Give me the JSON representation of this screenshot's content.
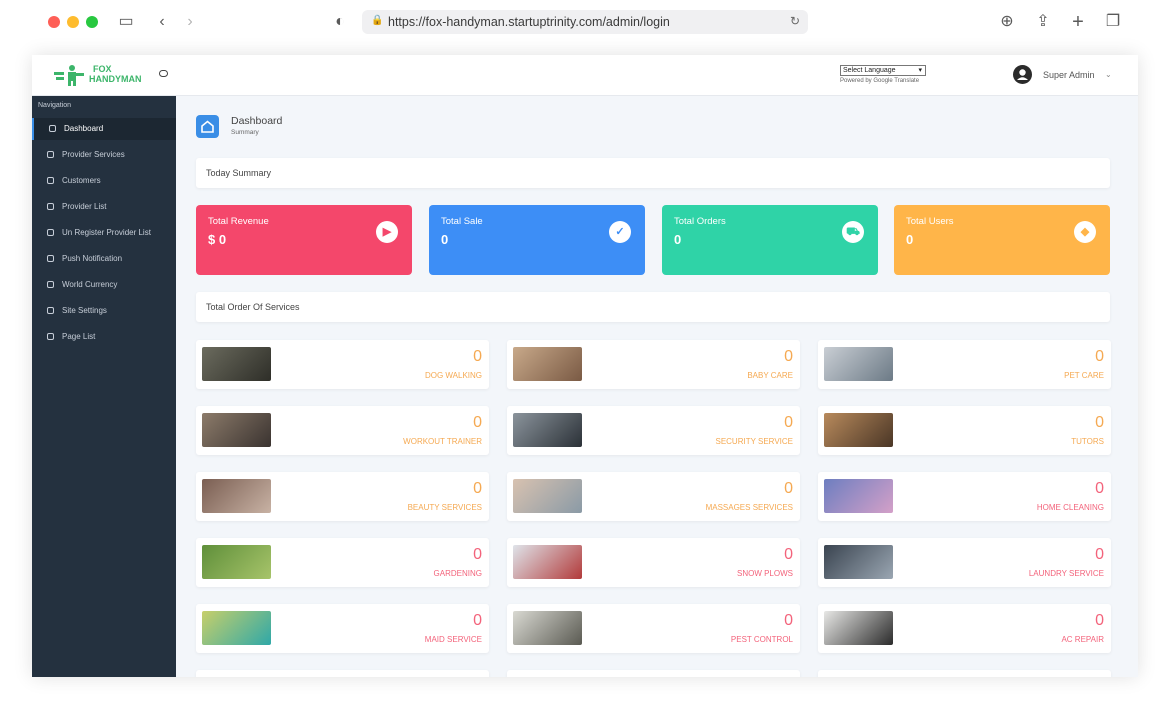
{
  "browser": {
    "url": "https://fox-handyman.startuptrinity.com/admin/login"
  },
  "header": {
    "logo_line1": "FOX",
    "logo_line2": "HANDYMAN",
    "language_select": "Select Language",
    "powered_by": "Powered by Google Translate",
    "user_name": "Super Admin"
  },
  "sidebar": {
    "heading": "Navigation",
    "items": [
      {
        "label": "Dashboard",
        "active": true
      },
      {
        "label": "Provider Services"
      },
      {
        "label": "Customers"
      },
      {
        "label": "Provider List"
      },
      {
        "label": "Un Register Provider List"
      },
      {
        "label": "Push Notification"
      },
      {
        "label": "World Currency"
      },
      {
        "label": "Site Settings"
      },
      {
        "label": "Page List"
      }
    ]
  },
  "page": {
    "title": "Dashboard",
    "subtitle": "Summary",
    "today_summary": "Today Summary",
    "total_order_services": "Total Order Of Services"
  },
  "stats": [
    {
      "label": "Total Revenue",
      "value": "$ 0",
      "color": "#f4476b",
      "icon": "youtube-icon"
    },
    {
      "label": "Total Sale",
      "value": "0",
      "color": "#3d8ef6",
      "icon": "clipboard-check-icon"
    },
    {
      "label": "Total Orders",
      "value": "0",
      "color": "#2fd3a7",
      "icon": "cart-icon"
    },
    {
      "label": "Total Users",
      "value": "0",
      "color": "#ffb549",
      "icon": "tags-icon"
    }
  ],
  "services": [
    {
      "label": "DOG WALKING",
      "count": "0"
    },
    {
      "label": "BABY CARE",
      "count": "0"
    },
    {
      "label": "PET CARE",
      "count": "0"
    },
    {
      "label": "WORKOUT TRAINER",
      "count": "0"
    },
    {
      "label": "SECURITY SERVICE",
      "count": "0"
    },
    {
      "label": "TUTORS",
      "count": "0"
    },
    {
      "label": "BEAUTY SERVICES",
      "count": "0"
    },
    {
      "label": "MASSAGES SERVICES",
      "count": "0"
    },
    {
      "label": "HOME CLEANING",
      "count": "0"
    },
    {
      "label": "GARDENING",
      "count": "0"
    },
    {
      "label": "SNOW PLOWS",
      "count": "0"
    },
    {
      "label": "LAUNDRY SERVICE",
      "count": "0"
    },
    {
      "label": "MAID SERVICE",
      "count": "0"
    },
    {
      "label": "PEST CONTROL",
      "count": "0"
    },
    {
      "label": "AC REPAIR",
      "count": "0"
    }
  ]
}
